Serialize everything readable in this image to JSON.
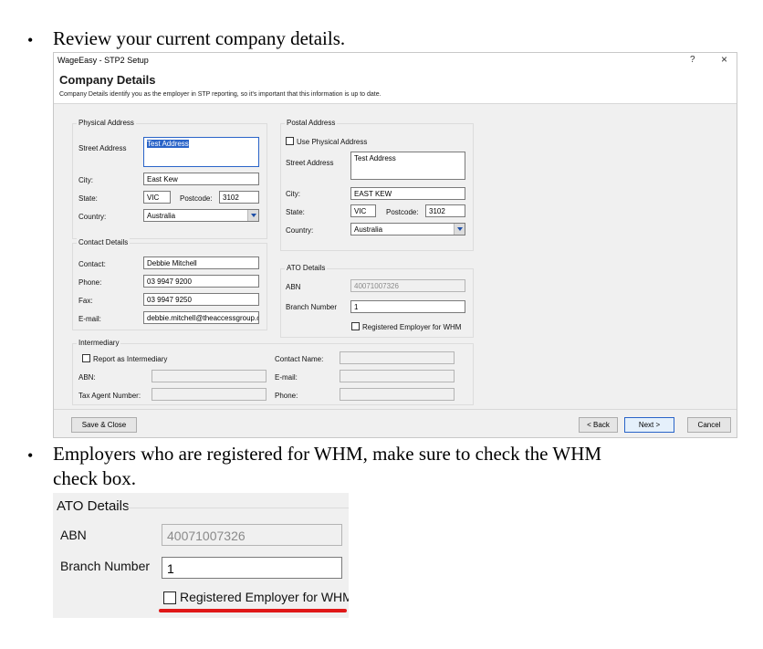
{
  "doc": {
    "bullet1": "Review your current company details.",
    "bullet2_line1": "Employers who are registered for WHM, make sure to check the WHM",
    "bullet2_line2": "check box.",
    "bullet_glyph": "•"
  },
  "window": {
    "title": "WageEasy - STP2 Setup",
    "help_glyph": "?",
    "close_glyph": "×",
    "header_title": "Company Details",
    "header_subtitle": "Company Details identify you as the employer in STP reporting, so it's important that this information is up to date."
  },
  "physical_address": {
    "legend": "Physical Address",
    "street_label": "Street Address",
    "street_value": "Test Address",
    "city_label": "City:",
    "city_value": "East Kew",
    "state_label": "State:",
    "state_value": "VIC",
    "postcode_label": "Postcode:",
    "postcode_value": "3102",
    "country_label": "Country:",
    "country_value": "Australia"
  },
  "postal_address": {
    "legend": "Postal Address",
    "use_physical_label": "Use Physical Address",
    "use_physical_checked": false,
    "street_label": "Street Address",
    "street_value": "Test Address",
    "city_label": "City:",
    "city_value": "EAST KEW",
    "state_label": "State:",
    "state_value": "VIC",
    "postcode_label": "Postcode:",
    "postcode_value": "3102",
    "country_label": "Country:",
    "country_value": "Australia"
  },
  "contact_details": {
    "legend": "Contact Details",
    "contact_label": "Contact:",
    "contact_value": "Debbie Mitchell",
    "phone_label": "Phone:",
    "phone_value": "03 9947 9200",
    "fax_label": "Fax:",
    "fax_value": "03 9947 9250",
    "email_label": "E-mail:",
    "email_value": "debbie.mitchell@theaccessgroup.c"
  },
  "ato_details": {
    "legend": "ATO Details",
    "abn_label": "ABN",
    "abn_value": "40071007326",
    "branch_label": "Branch Number",
    "branch_value": "1",
    "whm_label": "Registered Employer for WHM",
    "whm_checked": false
  },
  "intermediary": {
    "legend": "Intermediary",
    "report_label": "Report as Intermediary",
    "abn_label": "ABN:",
    "tax_agent_label": "Tax Agent Number:",
    "contact_name_label": "Contact Name:",
    "email_label": "E-mail:",
    "phone_label": "Phone:"
  },
  "buttons": {
    "save_close": "Save & Close",
    "back": "< Back",
    "next": "Next >",
    "cancel": "Cancel"
  },
  "zoom": {
    "legend": "ATO Details",
    "abn_label": "ABN",
    "abn_value": "40071007326",
    "branch_label": "Branch Number",
    "branch_value": "1",
    "whm_label": "Registered Employer for WHM",
    "highlight_color": "#e01818"
  },
  "colors": {
    "dialog_bg": "#f0f0f0",
    "focus_blue": "#2a64c8",
    "underline_red": "#e01818"
  }
}
